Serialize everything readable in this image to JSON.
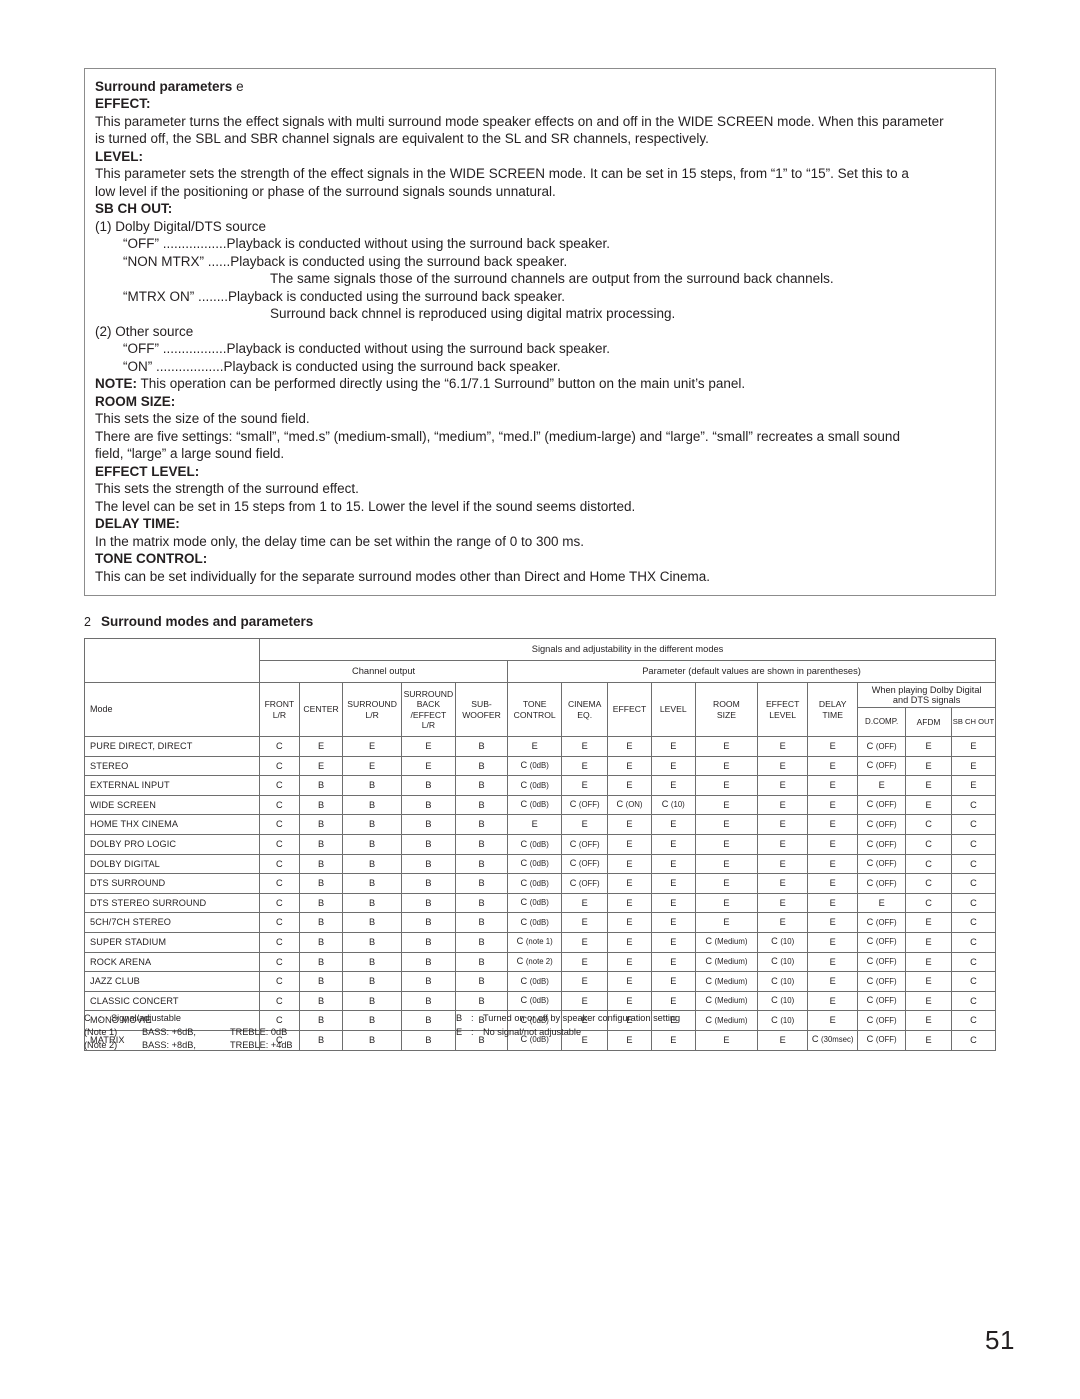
{
  "param_box": {
    "title_bold": "Surround parameters",
    "title_light": "e",
    "sections": [
      {
        "heading": "EFFECT:",
        "lines": [
          "This parameter turns the effect signals with multi surround mode speaker effects on and off in the WIDE SCREEN mode.  When this parameter",
          "is turned off, the SBL and SBR channel signals are equivalent to the SL and SR channels, respectively."
        ]
      },
      {
        "heading": "LEVEL:",
        "lines": [
          "This parameter sets the strength of the effect signals in the WIDE SCREEN mode.  It can be set in 15 steps, from “1” to “15”.  Set this to a",
          "low level if the positioning or phase of the surround signals sounds unnatural."
        ]
      }
    ],
    "sb_ch_out": {
      "heading": "SB CH OUT:",
      "group1_label": "(1) Dolby Digital/DTS source",
      "group1_items": [
        {
          "key": "“OFF” .................",
          "value": "Playback is conducted without using the surround back speaker."
        },
        {
          "key": "“NON MTRX” ......",
          "value": "Playback is conducted using the surround back speaker."
        },
        {
          "key": "",
          "value": "The same signals those of the surround channels are output from the surround back channels.",
          "cont": true
        },
        {
          "key": "“MTRX ON” ........",
          "value": "Playback is conducted using the surround back speaker."
        },
        {
          "key": "",
          "value": "Surround back chnnel is reproduced using digital matrix processing.",
          "cont": true
        }
      ],
      "group2_label": "(2) Other source",
      "group2_items": [
        {
          "key": "“OFF” .................",
          "value": "Playback is conducted without using the surround back speaker."
        },
        {
          "key": "“ON” ..................",
          "value": "Playback is conducted using the surround back speaker."
        }
      ]
    },
    "note": {
      "label": "NOTE:",
      "text": " This operation can be performed directly using the “6.1/7.1 Surround” button on the main unit’s panel."
    },
    "sections2": [
      {
        "heading": "ROOM SIZE:",
        "lines": [
          "This sets the size of the sound field.",
          "There are five settings: “small”, “med.s” (medium-small), “medium”, “med.l” (medium-large) and “large”. “small” recreates a small sound",
          "field, “large” a large sound field."
        ]
      },
      {
        "heading": "EFFECT LEVEL:",
        "lines": [
          "This sets the strength of the surround effect.",
          "The level can be set in 15 steps from 1 to 15. Lower the level if the sound seems distorted."
        ]
      },
      {
        "heading": "DELAY TIME:",
        "lines": [
          "In the matrix mode only, the delay time can be set within the range of 0 to 300 ms."
        ]
      },
      {
        "heading": "TONE CONTROL:",
        "lines": [
          "This can be set individually for the separate surround modes other than Direct and Home THX Cinema."
        ]
      }
    ]
  },
  "section2": {
    "number": "2",
    "title": "Surround modes and parameters"
  },
  "table": {
    "band_title": "Signals and adjustability in the different modes",
    "group_channel": "Channel output",
    "group_parameter": "Parameter (default values are shown in parentheses)",
    "group_dolby": "When playing Dolby Digital\nand DTS signals",
    "mode_header": "Mode",
    "columns": [
      "FRONT\nL/R",
      "CENTER",
      "SURROUND\nL/R",
      "SURROUND\nBACK\n/EFFECT\nL/R",
      "SUB-\nWOOFER",
      "TONE\nCONTROL",
      "CINEMA\nEQ.",
      "EFFECT",
      "LEVEL",
      "ROOM\nSIZE",
      "EFFECT\nLEVEL",
      "DELAY\nTIME",
      "D.COMP.",
      "AFDM",
      "SB CH OUT"
    ],
    "rows": [
      {
        "mode": "PURE DIRECT, DIRECT",
        "cells": [
          "C",
          "E",
          "E",
          "E",
          "B",
          "E",
          "E",
          "E",
          "E",
          "E",
          "E",
          "E",
          "C (OFF)",
          "E",
          "E"
        ]
      },
      {
        "mode": "STEREO",
        "cells": [
          "C",
          "E",
          "E",
          "E",
          "B",
          "C (0dB)",
          "E",
          "E",
          "E",
          "E",
          "E",
          "E",
          "C (OFF)",
          "E",
          "E"
        ]
      },
      {
        "mode": "EXTERNAL INPUT",
        "cells": [
          "C",
          "B",
          "B",
          "B",
          "B",
          "C (0dB)",
          "E",
          "E",
          "E",
          "E",
          "E",
          "E",
          "E",
          "E",
          "E"
        ]
      },
      {
        "mode": "WIDE SCREEN",
        "cells": [
          "C",
          "B",
          "B",
          "B",
          "B",
          "C (0dB)",
          "C (OFF)",
          "C (ON)",
          "C (10)",
          "E",
          "E",
          "E",
          "C (OFF)",
          "E",
          "C"
        ]
      },
      {
        "mode": "HOME THX CINEMA",
        "cells": [
          "C",
          "B",
          "B",
          "B",
          "B",
          "E",
          "E",
          "E",
          "E",
          "E",
          "E",
          "E",
          "C (OFF)",
          "C",
          "C"
        ]
      },
      {
        "mode": "DOLBY PRO LOGIC",
        "cells": [
          "C",
          "B",
          "B",
          "B",
          "B",
          "C (0dB)",
          "C (OFF)",
          "E",
          "E",
          "E",
          "E",
          "E",
          "C (OFF)",
          "C",
          "C"
        ]
      },
      {
        "mode": "DOLBY DIGITAL",
        "cells": [
          "C",
          "B",
          "B",
          "B",
          "B",
          "C (0dB)",
          "C (OFF)",
          "E",
          "E",
          "E",
          "E",
          "E",
          "C (OFF)",
          "C",
          "C"
        ]
      },
      {
        "mode": "DTS SURROUND",
        "cells": [
          "C",
          "B",
          "B",
          "B",
          "B",
          "C (0dB)",
          "C (OFF)",
          "E",
          "E",
          "E",
          "E",
          "E",
          "C (OFF)",
          "C",
          "C"
        ]
      },
      {
        "mode": "DTS STEREO SURROUND",
        "cells": [
          "C",
          "B",
          "B",
          "B",
          "B",
          "C (0dB)",
          "E",
          "E",
          "E",
          "E",
          "E",
          "E",
          "E",
          "C",
          "C"
        ]
      },
      {
        "mode": "5CH/7CH STEREO",
        "cells": [
          "C",
          "B",
          "B",
          "B",
          "B",
          "C (0dB)",
          "E",
          "E",
          "E",
          "E",
          "E",
          "E",
          "C (OFF)",
          "E",
          "C"
        ]
      },
      {
        "mode": "SUPER STADIUM",
        "cells": [
          "C",
          "B",
          "B",
          "B",
          "B",
          "C (note 1)",
          "E",
          "E",
          "E",
          "C (Medium)",
          "C (10)",
          "E",
          "C (OFF)",
          "E",
          "C"
        ]
      },
      {
        "mode": "ROCK ARENA",
        "cells": [
          "C",
          "B",
          "B",
          "B",
          "B",
          "C (note 2)",
          "E",
          "E",
          "E",
          "C (Medium)",
          "C (10)",
          "E",
          "C (OFF)",
          "E",
          "C"
        ]
      },
      {
        "mode": "JAZZ CLUB",
        "cells": [
          "C",
          "B",
          "B",
          "B",
          "B",
          "C (0dB)",
          "E",
          "E",
          "E",
          "C (Medium)",
          "C (10)",
          "E",
          "C (OFF)",
          "E",
          "C"
        ]
      },
      {
        "mode": "CLASSIC CONCERT",
        "cells": [
          "C",
          "B",
          "B",
          "B",
          "B",
          "C (0dB)",
          "E",
          "E",
          "E",
          "C (Medium)",
          "C (10)",
          "E",
          "C (OFF)",
          "E",
          "C"
        ]
      },
      {
        "mode": "MONO MOVIE",
        "cells": [
          "C",
          "B",
          "B",
          "B",
          "B",
          "C (0dB)",
          "E",
          "E",
          "E",
          "C (Medium)",
          "C (10)",
          "E",
          "C (OFF)",
          "E",
          "C"
        ]
      },
      {
        "mode": "MATRIX",
        "cells": [
          "C",
          "B",
          "B",
          "B",
          "B",
          "C (0dB)",
          "E",
          "E",
          "E",
          "E",
          "E",
          "C (30msec)",
          "C (OFF)",
          "E",
          "C"
        ]
      }
    ]
  },
  "legend": {
    "c_sym": "C",
    "c_text": "Signal/adjustable",
    "b_sym": "B",
    "b_text": "Turned on or off by speaker configuration setting",
    "e_sym": "E",
    "e_text": "No signal/not adjustable",
    "note1_label": "(Note 1)",
    "note1_bass": "BASS: +6dB,",
    "note1_treble": "TREBLE: 0dB",
    "note2_label": "(Note 2)",
    "note2_bass": "BASS: +8dB,",
    "note2_treble": "TREBLE: +4dB"
  },
  "page_number": "51"
}
